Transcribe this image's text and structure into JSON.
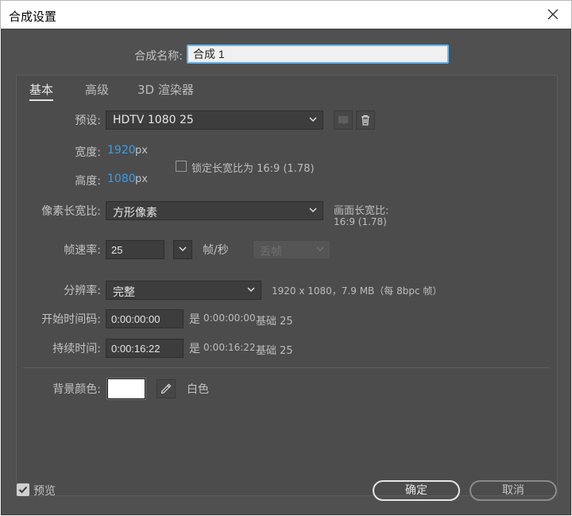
{
  "window": {
    "title": "合成设置"
  },
  "composition": {
    "name_label": "合成名称:",
    "name_value": "合成 1"
  },
  "tabs": [
    {
      "label": "基本"
    },
    {
      "label": "高级"
    },
    {
      "label": "3D 渲染器"
    }
  ],
  "preset": {
    "label": "预设:",
    "value": "HDTV 1080 25"
  },
  "size": {
    "width_label": "宽度:",
    "width_value": "1920",
    "width_unit": "px",
    "height_label": "高度:",
    "height_value": "1080",
    "height_unit": "px",
    "lock_label": "锁定长宽比为 16:9 (1.78)"
  },
  "pixel_aspect": {
    "label": "像素长宽比:",
    "value": "方形像素",
    "frame_aspect_label": "画面长宽比:",
    "frame_aspect_value": "16:9 (1.78)"
  },
  "frame_rate": {
    "label": "帧速率:",
    "value": "25",
    "unit": "帧/秒",
    "drop_frame": "丢帧"
  },
  "resolution": {
    "label": "分辨率:",
    "value": "完整",
    "info": "1920 x 1080，7.9 MB（每 8bpc 帧）"
  },
  "timecode": {
    "start_label": "开始时间码:",
    "start_value": "0:00:00:00",
    "start_is": "是",
    "start_note_time": "0:00:00:00",
    "start_note_base": "基础 25",
    "duration_label": "持续时间:",
    "duration_value": "0:00:16:22",
    "duration_is": "是",
    "duration_note_time": "0:00:16:22",
    "duration_note_base": "基础 25"
  },
  "background": {
    "label": "背景颜色:",
    "color": "#ffffff",
    "name": "白色"
  },
  "footer": {
    "preview_label": "预览",
    "ok_label": "确定",
    "cancel_label": "取消"
  }
}
